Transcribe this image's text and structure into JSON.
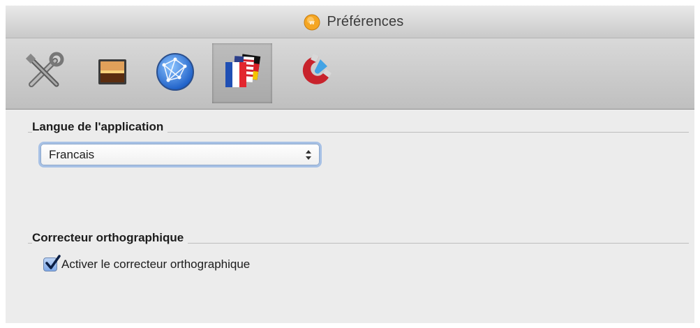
{
  "window": {
    "title": "Préférences"
  },
  "toolbar": {
    "items": [
      {
        "name": "general",
        "icon": "tools-icon",
        "active": false
      },
      {
        "name": "display",
        "icon": "image-icon",
        "active": false
      },
      {
        "name": "network",
        "icon": "globe-icon",
        "active": false
      },
      {
        "name": "language",
        "icon": "flags-icon",
        "active": true
      },
      {
        "name": "advanced",
        "icon": "magnet-icon",
        "active": false
      }
    ]
  },
  "sections": {
    "language": {
      "title": "Langue de l'application",
      "select_value": "Francais"
    },
    "spellcheck": {
      "title": "Correcteur orthographique",
      "checkbox_label": "Activer le correcteur orthographique",
      "checked": true
    }
  },
  "colors": {
    "focus_ring": "#6f9ee0",
    "checkbox_fill": "#7fa9e8",
    "active_tab": "#b3b3b3"
  }
}
